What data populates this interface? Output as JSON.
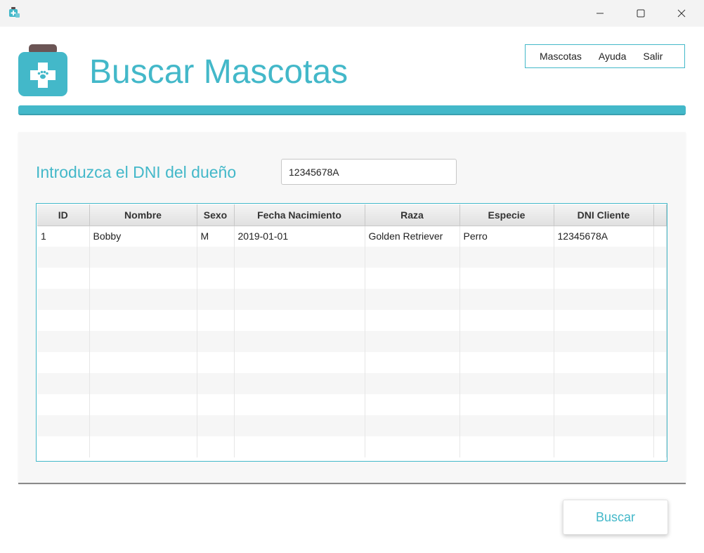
{
  "window": {
    "app_icon": "vet-clinic-icon"
  },
  "header": {
    "title": "Buscar Mascotas",
    "logo_icon": "pet-medical-jar-icon",
    "accent_color": "#43b8c9"
  },
  "menu": {
    "items": [
      "Mascotas",
      "Ayuda",
      "Salir"
    ]
  },
  "search": {
    "label": "Introduzca el DNI del dueño",
    "value": "12345678A",
    "button_label": "Buscar"
  },
  "table": {
    "columns": [
      "ID",
      "Nombre",
      "Sexo",
      "Fecha Nacimiento",
      "Raza",
      "Especie",
      "DNI Cliente"
    ],
    "rows": [
      [
        "1",
        "Bobby",
        "M",
        "2019-01-01",
        "Golden Retriever",
        "Perro",
        "12345678A"
      ]
    ]
  }
}
